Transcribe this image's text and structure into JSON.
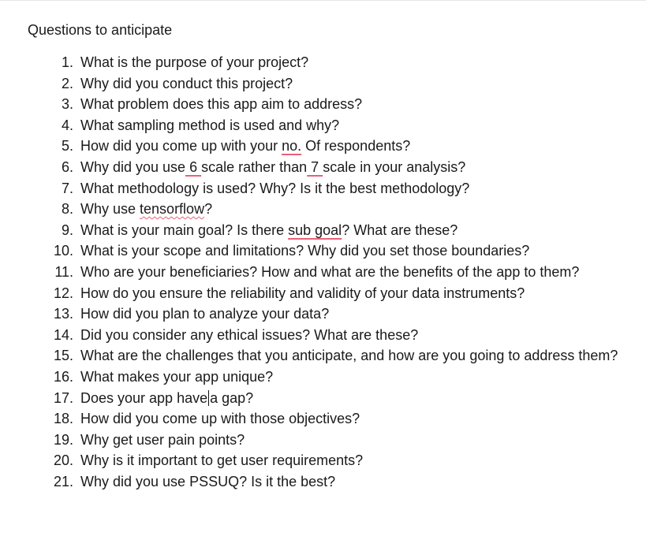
{
  "heading": "Questions to anticipate",
  "questions": [
    {
      "num": "1.",
      "parts": [
        "What is the purpose of your project?"
      ]
    },
    {
      "num": "2.",
      "parts": [
        "Why did you conduct this project?"
      ]
    },
    {
      "num": "3.",
      "parts": [
        "What problem does this app aim to address?"
      ]
    },
    {
      "num": "4.",
      "parts": [
        "What sampling method is used and why?"
      ]
    },
    {
      "num": "5.",
      "parts": [
        "How did you come up with your ",
        "no.",
        " Of respondents?"
      ]
    },
    {
      "num": "6.",
      "parts": [
        "Why did you use",
        " 6 ",
        "scale rather than",
        " 7 ",
        "scale in your analysis?"
      ]
    },
    {
      "num": "7.",
      "parts": [
        "What methodology is used? Why? Is it the best methodology?"
      ]
    },
    {
      "num": "8.",
      "parts": [
        "Why use ",
        "tensorflow",
        "?"
      ]
    },
    {
      "num": "9.",
      "parts": [
        "What is your main goal? Is there ",
        "sub goal",
        "? What are these?"
      ]
    },
    {
      "num": "10.",
      "parts": [
        "What is your scope and limitations? Why did you set those boundaries?"
      ]
    },
    {
      "num": "11.",
      "parts": [
        "Who are your beneficiaries? How and what are the benefits of the app to them?"
      ]
    },
    {
      "num": "12.",
      "parts": [
        "How do you ensure the reliability and validity of your data instruments?"
      ]
    },
    {
      "num": "13.",
      "parts": [
        "How did you plan to analyze your data?"
      ]
    },
    {
      "num": "14.",
      "parts": [
        "Did you consider any ethical issues? What are these?"
      ]
    },
    {
      "num": "15.",
      "parts": [
        "What are the challenges that you anticipate, and how are you going to address them?"
      ]
    },
    {
      "num": "16.",
      "parts": [
        "What makes your app unique?"
      ]
    },
    {
      "num": "17.",
      "parts": [
        "Does your app have",
        "a gap?"
      ]
    },
    {
      "num": "18.",
      "parts": [
        "How did you come up with those objectives?"
      ]
    },
    {
      "num": "19.",
      "parts": [
        "Why get user pain points?"
      ]
    },
    {
      "num": "20.",
      "parts": [
        "Why is it important to get user requirements?"
      ]
    },
    {
      "num": "21.",
      "parts": [
        "Why did you use PSSUQ? Is it the best?"
      ]
    }
  ]
}
